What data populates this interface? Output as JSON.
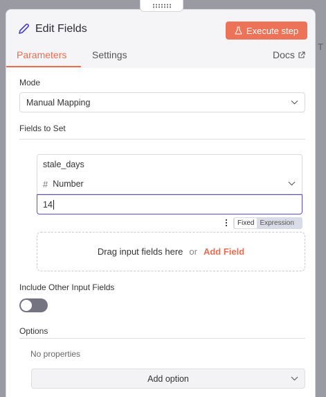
{
  "background": {
    "edge_letter": "T"
  },
  "header": {
    "title": "Edit Fields",
    "execute_label": "Execute step",
    "accent_color": "#ec7358"
  },
  "tabs": [
    {
      "label": "Parameters",
      "active": true
    },
    {
      "label": "Settings",
      "active": false
    },
    {
      "label": "Docs",
      "active": false
    }
  ],
  "mode": {
    "label": "Mode",
    "value": "Manual Mapping"
  },
  "fields_to_set": {
    "label": "Fields to Set",
    "field": {
      "name": "stale_days",
      "type_icon": "#",
      "type": "Number",
      "value": "14"
    },
    "value_mode": {
      "fixed": "Fixed",
      "expression": "Expression",
      "selected": "Fixed"
    },
    "drop_zone": {
      "text": "Drag input fields here",
      "or": "or",
      "add_label": "Add Field"
    }
  },
  "include_other": {
    "label": "Include Other Input Fields",
    "enabled": false
  },
  "options": {
    "label": "Options",
    "empty_text": "No properties",
    "add_label": "Add option"
  }
}
